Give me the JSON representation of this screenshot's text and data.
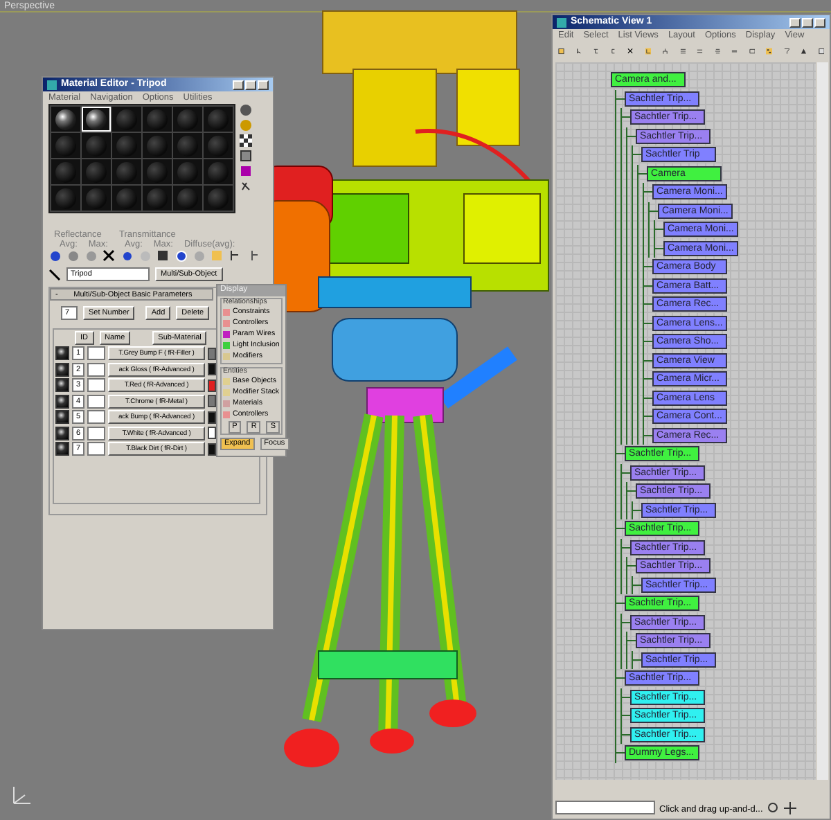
{
  "viewport": {
    "label": "Perspective"
  },
  "material_editor": {
    "title": "Material Editor - Tripod",
    "menu": [
      "Material",
      "Navigation",
      "Options",
      "Utilities"
    ],
    "slots": [
      {
        "filled": true,
        "selected": false
      },
      {
        "filled": true,
        "selected": true
      },
      {
        "filled": false,
        "selected": false
      },
      {
        "filled": false,
        "selected": false
      },
      {
        "filled": false,
        "selected": false
      },
      {
        "filled": false,
        "selected": false
      },
      {
        "filled": false,
        "selected": false
      },
      {
        "filled": false,
        "selected": false
      },
      {
        "filled": false,
        "selected": false
      },
      {
        "filled": false,
        "selected": false
      },
      {
        "filled": false,
        "selected": false
      },
      {
        "filled": false,
        "selected": false
      },
      {
        "filled": false,
        "selected": false
      },
      {
        "filled": false,
        "selected": false
      },
      {
        "filled": false,
        "selected": false
      },
      {
        "filled": false,
        "selected": false
      },
      {
        "filled": false,
        "selected": false
      },
      {
        "filled": false,
        "selected": false
      },
      {
        "filled": false,
        "selected": false
      },
      {
        "filled": false,
        "selected": false
      },
      {
        "filled": false,
        "selected": false
      },
      {
        "filled": false,
        "selected": false
      },
      {
        "filled": false,
        "selected": false
      },
      {
        "filled": false,
        "selected": false
      }
    ],
    "reflectance": {
      "label": "Reflectance",
      "avg": "Avg:",
      "max": "Max:"
    },
    "transmittance": {
      "label": "Transmittance",
      "avg": "Avg:",
      "max": "Max:",
      "diffuse": "Diffuse(avg):"
    },
    "material_name": "Tripod",
    "type_button": "Multi/Sub-Object",
    "rollout": {
      "toggle": "-",
      "title": "Multi/Sub-Object Basic Parameters",
      "count": "7",
      "set_number": "Set Number",
      "add": "Add",
      "delete": "Delete",
      "columns": [
        "ID",
        "Name",
        "Sub-Material"
      ],
      "rows": [
        {
          "id": "1",
          "sub_material": "T.Grey Bump F  ( fR-Filler )",
          "color": "#777777"
        },
        {
          "id": "2",
          "sub_material": "ack Gloss  ( fR-Advanced )",
          "color": "#111111"
        },
        {
          "id": "3",
          "sub_material": "T.Red  ( fR-Advanced )",
          "color": "#e02020"
        },
        {
          "id": "4",
          "sub_material": "T.Chrome  ( fR-Metal )",
          "color": "#777777"
        },
        {
          "id": "5",
          "sub_material": "ack Bump  ( fR-Advanced )",
          "color": "#111111"
        },
        {
          "id": "6",
          "sub_material": "T.White  ( fR-Advanced )",
          "color": "#ffffff"
        },
        {
          "id": "7",
          "sub_material": "T.Black Dirt  ( fR-Dirt )",
          "color": "#111111"
        }
      ]
    }
  },
  "display_panel": {
    "title": "Display",
    "relationships": {
      "label": "Relationships",
      "items": [
        {
          "label": "Constraints",
          "color": "#e89090"
        },
        {
          "label": "Controllers",
          "color": "#e89090"
        },
        {
          "label": "Param Wires",
          "color": "#c020c0"
        },
        {
          "label": "Light Inclusion",
          "color": "#40d040"
        },
        {
          "label": "Modifiers",
          "color": "#d8c890"
        }
      ]
    },
    "entities": {
      "label": "Entities",
      "items": [
        {
          "label": "Base Objects",
          "color": "#e0d090"
        },
        {
          "label": "Modifier Stack",
          "color": "#e0d090"
        },
        {
          "label": "Materials",
          "color": "#d0a0a0"
        },
        {
          "label": "Controllers",
          "color": "#e89090"
        }
      ],
      "buttons": [
        "P",
        "R",
        "S"
      ]
    },
    "modes": [
      {
        "label": "Expand",
        "selected": true
      },
      {
        "label": "Focus",
        "selected": false
      }
    ]
  },
  "schematic": {
    "title": "Schematic View 1",
    "menu": [
      "Edit",
      "Select",
      "List Views",
      "Layout",
      "Options",
      "Display",
      "View"
    ],
    "tree": [
      {
        "label": "Camera and...",
        "color": "#40f040",
        "children": [
          {
            "label": "Sachtler Trip...",
            "color": "#8080ff",
            "children": [
              {
                "label": "Sachtler Trip...",
                "color": "#9a80f0",
                "children": [
                  {
                    "label": "Sachtler Trip...",
                    "color": "#9a80f0",
                    "children": [
                      {
                        "label": "Sachtler Trip",
                        "color": "#8080ff",
                        "children": [
                          {
                            "label": "Camera",
                            "color": "#40f040",
                            "children": [
                              {
                                "label": "Camera Moni...",
                                "color": "#8080ff",
                                "children": [
                                  {
                                    "label": "Camera Moni...",
                                    "color": "#8080ff",
                                    "children": [
                                      {
                                        "label": "Camera Moni...",
                                        "color": "#8080ff"
                                      },
                                      {
                                        "label": "Camera Moni...",
                                        "color": "#8080ff"
                                      }
                                    ]
                                  }
                                ]
                              },
                              {
                                "label": "Camera Body",
                                "color": "#8080ff"
                              },
                              {
                                "label": "Camera Batt...",
                                "color": "#8080ff"
                              },
                              {
                                "label": "Camera Rec...",
                                "color": "#8080ff"
                              },
                              {
                                "label": "Camera Lens...",
                                "color": "#8080ff"
                              },
                              {
                                "label": "Camera Sho...",
                                "color": "#8080ff"
                              },
                              {
                                "label": "Camera View",
                                "color": "#8080ff"
                              },
                              {
                                "label": "Camera Micr...",
                                "color": "#8080ff"
                              },
                              {
                                "label": "Camera Lens",
                                "color": "#8080ff"
                              },
                              {
                                "label": "Camera Cont...",
                                "color": "#8080ff"
                              },
                              {
                                "label": "Camera Rec...",
                                "color": "#9a80f0"
                              }
                            ]
                          }
                        ]
                      }
                    ]
                  }
                ]
              }
            ]
          },
          {
            "label": "Sachtler Trip...",
            "color": "#40f040",
            "children": [
              {
                "label": "Sachtler Trip...",
                "color": "#9a80f0",
                "children": [
                  {
                    "label": "Sachtler Trip...",
                    "color": "#9a80f0",
                    "children": [
                      {
                        "label": "Sachtler Trip...",
                        "color": "#8080ff"
                      }
                    ]
                  }
                ]
              }
            ]
          },
          {
            "label": "Sachtler Trip...",
            "color": "#40f040",
            "children": [
              {
                "label": "Sachtler Trip...",
                "color": "#9a80f0",
                "children": [
                  {
                    "label": "Sachtler Trip...",
                    "color": "#9a80f0",
                    "children": [
                      {
                        "label": "Sachtler Trip...",
                        "color": "#8080ff"
                      }
                    ]
                  }
                ]
              }
            ]
          },
          {
            "label": "Sachtler Trip...",
            "color": "#40f040",
            "children": [
              {
                "label": "Sachtler Trip...",
                "color": "#9a80f0",
                "children": [
                  {
                    "label": "Sachtler Trip...",
                    "color": "#9a80f0",
                    "children": [
                      {
                        "label": "Sachtler Trip...",
                        "color": "#8080ff"
                      }
                    ]
                  }
                ]
              }
            ]
          },
          {
            "label": "Sachtler Trip...",
            "color": "#8080ff",
            "children": [
              {
                "label": "Sachtler Trip...",
                "color": "#30f0f0"
              },
              {
                "label": "Sachtler Trip...",
                "color": "#30f0f0"
              },
              {
                "label": "Sachtler Trip...",
                "color": "#30f0f0"
              }
            ]
          },
          {
            "label": "Dummy Legs...",
            "color": "#40f040"
          }
        ]
      }
    ],
    "status": "Click and drag up-and-d..."
  }
}
